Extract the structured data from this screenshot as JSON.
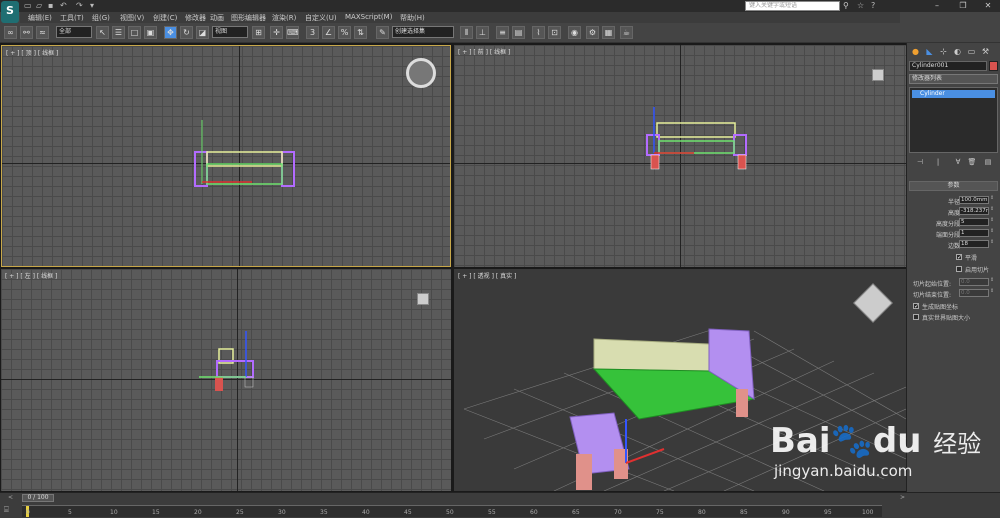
{
  "menu": [
    "编辑(E)",
    "工具(T)",
    "组(G)",
    "视图(V)",
    "创建(C)",
    "修改器",
    "动画",
    "图形编辑器",
    "渲染(R)",
    "自定义(U)",
    "MAXScript(M)",
    "帮助(H)"
  ],
  "search_placeholder": "键入关键字或短语",
  "toolbar": {
    "filter": "全部",
    "ref_coord": "视图",
    "selection_set": "创建选择集"
  },
  "viewports": {
    "top": "[ + ] [ 顶 ] [ 线框 ]",
    "front": "[ + ] [ 前 ] [ 线框 ]",
    "left": "[ + ] [ 左 ] [ 线框 ]",
    "persp": "[ + ] [ 透视 ] [ 真实 ]"
  },
  "command_panel": {
    "object_name": "Cylinder001",
    "modifier_list": "修改器列表",
    "stack_item": "Cylinder",
    "rollout_title": "参数",
    "params": [
      {
        "label": "半径:",
        "value": "100.0mm",
        "enabled": true
      },
      {
        "label": "高度:",
        "value": "-318.237r",
        "enabled": true
      },
      {
        "label": "高度分段:",
        "value": "5",
        "enabled": true
      },
      {
        "label": "端面分段:",
        "value": "1",
        "enabled": true
      },
      {
        "label": "边数:",
        "value": "18",
        "enabled": true
      }
    ],
    "smooth": {
      "label": "平滑",
      "checked": true
    },
    "slice": {
      "label": "启用切片",
      "checked": false
    },
    "slice_from": {
      "label": "切片起始位置:",
      "value": "0.0"
    },
    "slice_to": {
      "label": "切片结束位置:",
      "value": "0.0"
    },
    "gen_mapping": {
      "label": "生成贴图坐标",
      "checked": true
    },
    "real_world": {
      "label": "真实世界贴图大小",
      "checked": false
    }
  },
  "timeline": {
    "slider": "0 / 100",
    "ticks": [
      "0",
      "5",
      "10",
      "15",
      "20",
      "25",
      "30",
      "35",
      "40",
      "45",
      "50",
      "55",
      "60",
      "65",
      "70",
      "75",
      "80",
      "85",
      "90",
      "95",
      "100"
    ]
  },
  "watermark": {
    "brand": "Bai",
    "brand2": "du",
    "cn": "经验",
    "url": "jingyan.baidu.com"
  }
}
